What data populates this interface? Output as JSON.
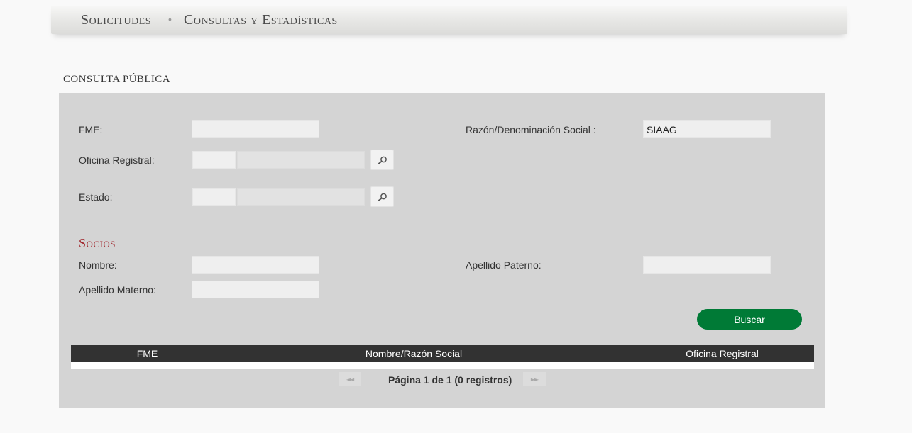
{
  "nav": {
    "items": [
      {
        "label": "Solicitudes"
      },
      {
        "label": "Consultas y Estadísticas"
      }
    ],
    "separator": "•"
  },
  "section_title": "Consulta Pública",
  "form": {
    "fme": {
      "label": "FME:",
      "value": ""
    },
    "razon_social": {
      "label": "Razón/Denominación Social :",
      "value": "SIAAG"
    },
    "oficina_registral": {
      "label": "Oficina Registral:",
      "code": "",
      "name": ""
    },
    "estado": {
      "label": "Estado:",
      "code": "",
      "name": ""
    },
    "search_icon": "magnifier-icon"
  },
  "socios": {
    "title": "Socios",
    "nombre": {
      "label": "Nombre:",
      "value": ""
    },
    "apellido_paterno": {
      "label": "Apellido Paterno:",
      "value": ""
    },
    "apellido_materno": {
      "label": "Apellido Materno:",
      "value": ""
    }
  },
  "buscar_label": "Buscar",
  "grid": {
    "columns": [
      "",
      "FME",
      "Nombre/Razón Social",
      "Oficina Registral"
    ],
    "rows": []
  },
  "pager": {
    "first_label": "◄◄",
    "next_label": "►►",
    "text": "Página 1 de 1 (0 registros)"
  },
  "colors": {
    "accent_green": "#007a36",
    "socios_red": "#a0252b",
    "grid_header": "#323232",
    "panel": "#d4d4d4"
  }
}
